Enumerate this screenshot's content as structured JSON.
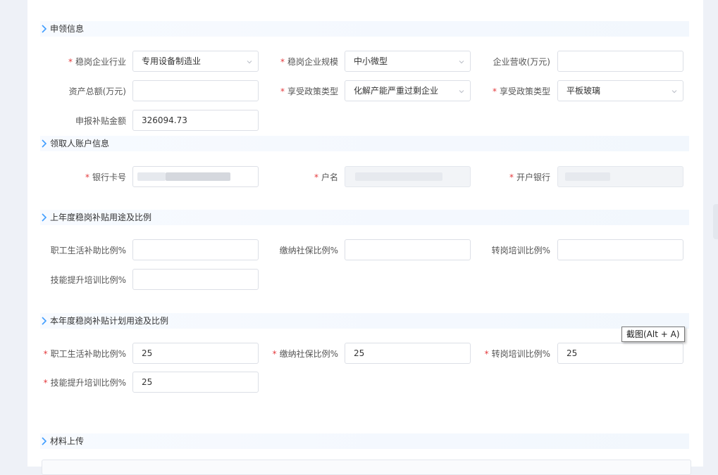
{
  "sections": {
    "apply_info": "申领信息",
    "account_info": "领取人账户信息",
    "last_year": "上年度稳岗补贴用途及比例",
    "this_year": "本年度稳岗补贴计划用途及比例",
    "upload": "材料上传"
  },
  "apply": {
    "industry_label": "稳岗企业行业",
    "industry_value": "专用设备制造业",
    "scale_label": "稳岗企业规模",
    "scale_value": "中小微型",
    "revenue_label": "企业营收(万元)",
    "revenue_value": "",
    "assets_label": "资产总额(万元)",
    "assets_value": "",
    "policy_type_label": "享受政策类型",
    "policy_type_value": "化解产能严重过剩企业",
    "policy_type2_label": "享受政策类型",
    "policy_type2_value": "平板玻璃",
    "subsidy_label": "申报补贴金额",
    "subsidy_value": "326094.73"
  },
  "account": {
    "card_label": "银行卡号",
    "name_label": "户名",
    "bank_label": "开户银行"
  },
  "last_year": {
    "living_label": "职工生活补助比例%",
    "living_value": "",
    "social_label": "缴纳社保比例%",
    "social_value": "",
    "transfer_label": "转岗培训比例%",
    "transfer_value": "",
    "skill_label": "技能提升培训比例%",
    "skill_value": ""
  },
  "this_year": {
    "living_label": "职工生活补助比例%",
    "living_value": "25",
    "social_label": "缴纳社保比例%",
    "social_value": "25",
    "transfer_label": "转岗培训比例%",
    "transfer_value": "25",
    "skill_label": "技能提升培训比例%",
    "skill_value": "25"
  },
  "tooltip": "截图(Alt + A)",
  "colors": {
    "accent": "#409eff",
    "required": "#e4393c",
    "border": "#dcdfe6",
    "disabled_bg": "#f2f4f7"
  }
}
